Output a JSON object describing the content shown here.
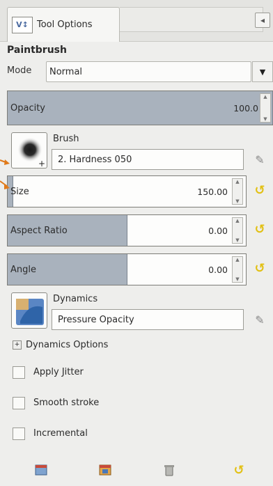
{
  "tab": {
    "label": "Tool Options",
    "icon": "tool-options-icon",
    "menu_icon": "tab-menu-icon",
    "menu_glyph": "◂"
  },
  "tool": {
    "title": "Paintbrush"
  },
  "mode": {
    "label": "Mode",
    "value": "Normal"
  },
  "opacity": {
    "label": "Opacity",
    "value": "100.0",
    "fill_fraction": 1.0
  },
  "brush": {
    "label": "Brush",
    "value": "2. Hardness 050"
  },
  "size": {
    "label": "Size",
    "value": "150.00",
    "fill_fraction": 0.02
  },
  "aspect_ratio": {
    "label": "Aspect Ratio",
    "value": "0.00",
    "fill_fraction": 0.5
  },
  "angle": {
    "label": "Angle",
    "value": "0.00",
    "fill_fraction": 0.5
  },
  "dynamics": {
    "label": "Dynamics",
    "value": "Pressure Opacity"
  },
  "dynamics_options": {
    "label": "Dynamics Options"
  },
  "checkboxes": {
    "apply_jitter": "Apply Jitter",
    "smooth_stroke": "Smooth stroke",
    "incremental": "Incremental"
  },
  "colors": {
    "slider_fill": "#a9b2bd",
    "accent_orange": "#e07a1a",
    "reset_yellow": "#e2c014"
  }
}
